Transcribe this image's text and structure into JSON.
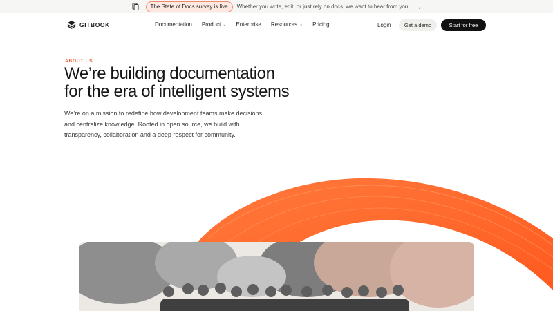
{
  "announcement": {
    "icon": "document-icon",
    "pill_label": "The State of Docs survey is live",
    "message": "Whether you write, edit, or just rely on docs, we want to hear from you!",
    "arrow": "→"
  },
  "nav": {
    "brand": "GITBOOK",
    "items": [
      {
        "label": "Documentation",
        "has_chevron": false
      },
      {
        "label": "Product",
        "has_chevron": true
      },
      {
        "label": "Enterprise",
        "has_chevron": false
      },
      {
        "label": "Resources",
        "has_chevron": true
      },
      {
        "label": "Pricing",
        "has_chevron": false
      }
    ],
    "chevron": "⌄",
    "login": "Login",
    "demo": "Get a demo",
    "start": "Start for free"
  },
  "hero": {
    "eyebrow": "ABOUT US",
    "headline_line1": "We’re building documentation",
    "headline_line2": "for the era of intelligent systems",
    "subtext": "We’re on a mission to redefine how development teams make decisions and centralize knowledge. Rooted in open source, we build with transparency, collaboration and a deep respect for community."
  },
  "colors": {
    "accent": "#e4572e",
    "arc_orange": "#ff6a2b",
    "button_dark": "#111111"
  }
}
